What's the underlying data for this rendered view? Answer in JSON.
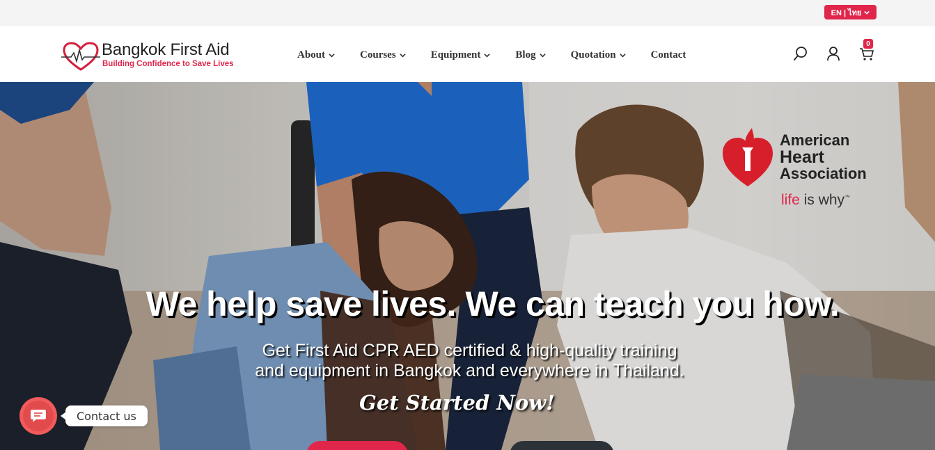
{
  "topbar": {
    "lang_label": "EN | ไทย"
  },
  "brand": {
    "name": "Bangkok First Aid",
    "tagline": "Building Confidence to Save Lives",
    "accent_color": "#e0264b"
  },
  "nav": {
    "items": [
      {
        "label": "About",
        "has_dropdown": true
      },
      {
        "label": "Courses",
        "has_dropdown": true
      },
      {
        "label": "Equipment",
        "has_dropdown": true
      },
      {
        "label": "Blog",
        "has_dropdown": true
      },
      {
        "label": "Quotation",
        "has_dropdown": true
      },
      {
        "label": "Contact",
        "has_dropdown": false
      }
    ]
  },
  "header_icons": {
    "search": "search-icon",
    "account": "user-icon",
    "cart": "cart-icon",
    "cart_count": "0"
  },
  "hero": {
    "title": "We help save lives. We can teach you how.",
    "subtitle_line1": "Get First Aid CPR AED certified & high-quality training",
    "subtitle_line2": "and equipment in Bangkok and everywhere in Thailand.",
    "cta": "Get Started Now!"
  },
  "aha": {
    "line1": "American",
    "line2": "Heart",
    "line3": "Association",
    "slogan_red": "life",
    "slogan_rest": " is why"
  },
  "contact_widget": {
    "label": "Contact us",
    "color": "#f25b5b"
  }
}
